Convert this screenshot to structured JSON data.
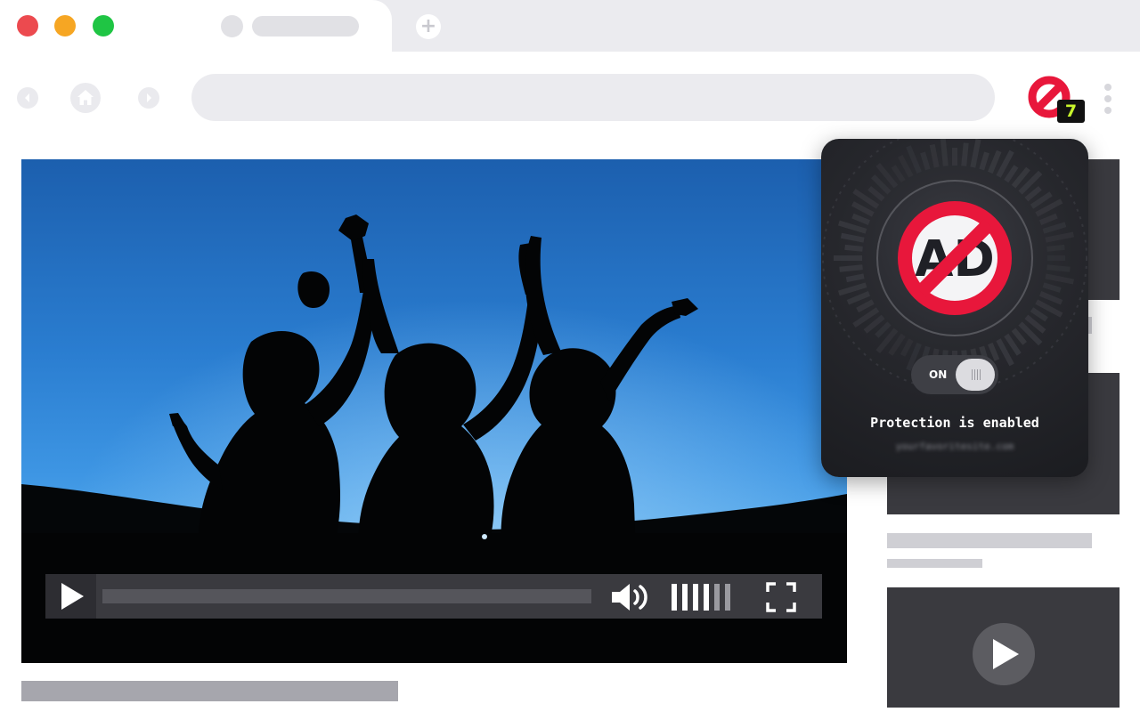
{
  "browser": {
    "window_controls": [
      "close",
      "minimize",
      "maximize"
    ],
    "new_tab_symbol": "+",
    "extension": {
      "icon": "ad-block-icon",
      "badge_count": "7",
      "brand_color": "#e8173b",
      "badge_color": "#c8f52c"
    },
    "menu_icon": "kebab-menu-icon"
  },
  "video_player": {
    "play_icon": "play-icon",
    "volume_icon": "volume-icon",
    "fullscreen_icon": "fullscreen-icon",
    "volume_level": 0.6
  },
  "popup": {
    "logo_icon": "no-ad-icon",
    "logo_text": "AD",
    "toggle_label": "ON",
    "toggle_state": true,
    "status": "Protection is enabled",
    "site": "yourfavoritesite.com"
  }
}
